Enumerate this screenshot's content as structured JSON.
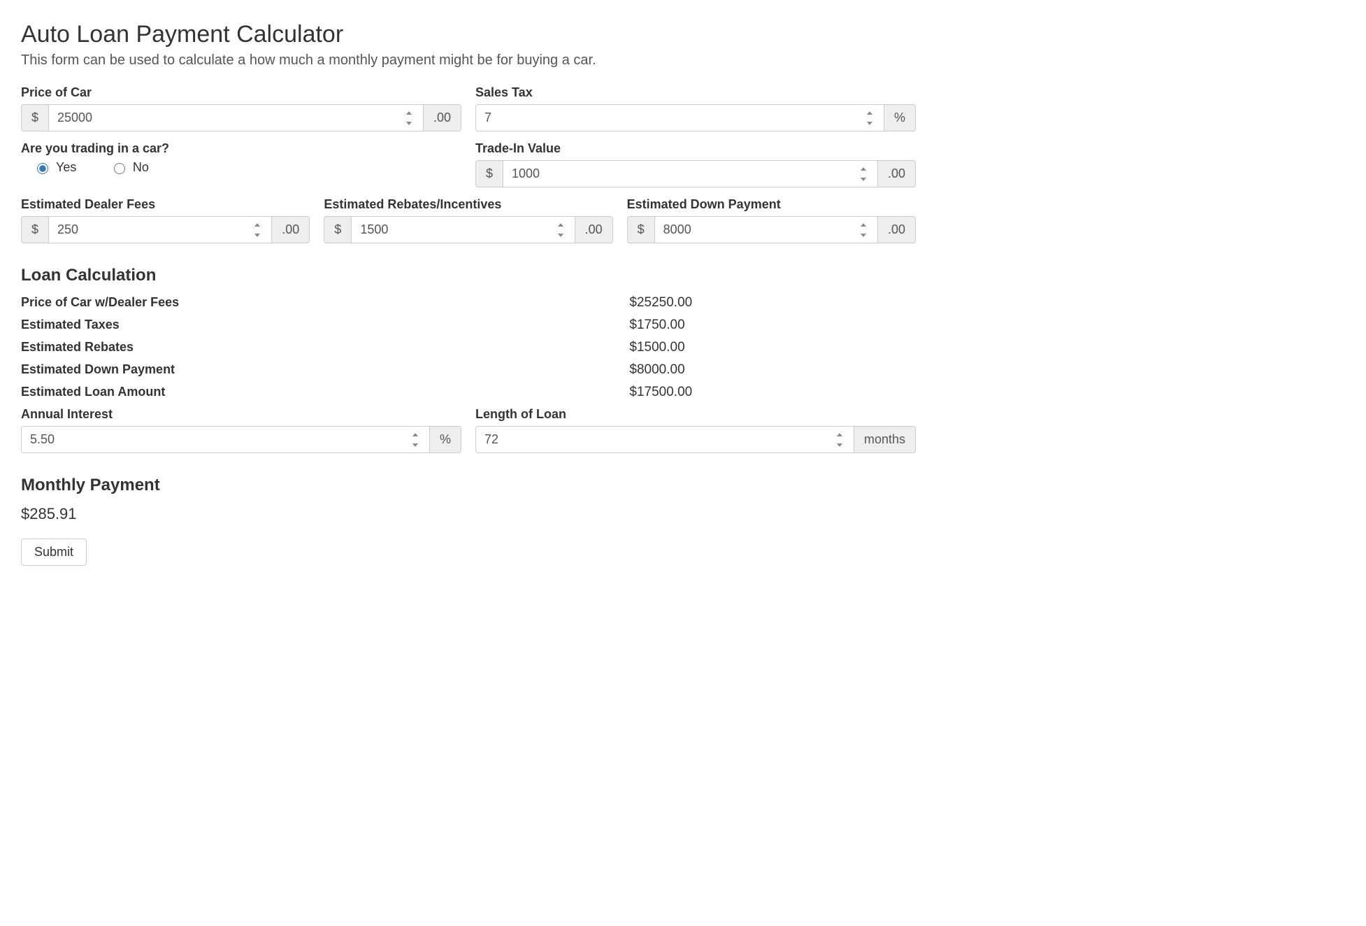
{
  "header": {
    "title": "Auto Loan Payment Calculator",
    "subtitle": "This form can be used to calculate a how much a monthly payment might be for buying a car."
  },
  "fields": {
    "price": {
      "label": "Price of Car",
      "value": "25000",
      "prefix": "$",
      "suffix": ".00"
    },
    "salesTax": {
      "label": "Sales Tax",
      "value": "7",
      "suffix": "%"
    },
    "tradeInQuestion": {
      "label": "Are you trading in a car?",
      "yes": "Yes",
      "no": "No",
      "selected": "yes"
    },
    "tradeInValue": {
      "label": "Trade-In Value",
      "value": "1000",
      "prefix": "$",
      "suffix": ".00"
    },
    "dealerFees": {
      "label": "Estimated Dealer Fees",
      "value": "250",
      "prefix": "$",
      "suffix": ".00"
    },
    "rebates": {
      "label": "Estimated Rebates/Incentives",
      "value": "1500",
      "prefix": "$",
      "suffix": ".00"
    },
    "downPayment": {
      "label": "Estimated Down Payment",
      "value": "8000",
      "prefix": "$",
      "suffix": ".00"
    },
    "annualInterest": {
      "label": "Annual Interest",
      "value": "5.50",
      "suffix": "%"
    },
    "loanLength": {
      "label": "Length of Loan",
      "value": "72",
      "suffix": "months"
    }
  },
  "calc": {
    "title": "Loan Calculation",
    "rows": [
      {
        "label": "Price of Car w/Dealer Fees",
        "value": "$25250.00"
      },
      {
        "label": "Estimated Taxes",
        "value": "$1750.00"
      },
      {
        "label": "Estimated Rebates",
        "value": "$1500.00"
      },
      {
        "label": "Estimated Down Payment",
        "value": "$8000.00"
      },
      {
        "label": "Estimated Loan Amount",
        "value": "$17500.00"
      }
    ]
  },
  "monthly": {
    "title": "Monthly Payment",
    "value": "$285.91"
  },
  "submit": {
    "label": "Submit"
  }
}
